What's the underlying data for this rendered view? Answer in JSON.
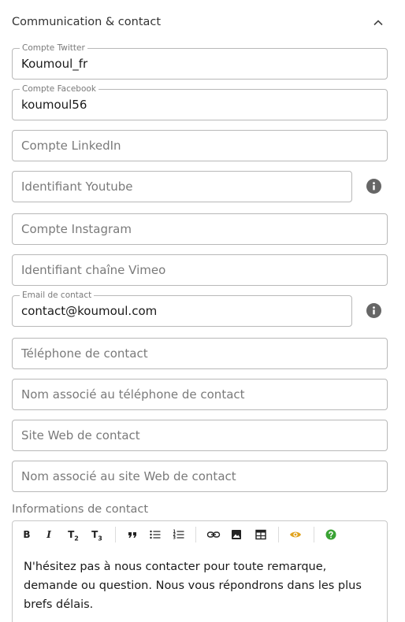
{
  "section": {
    "title": "Communication & contact"
  },
  "fields": [
    {
      "key": "twitter",
      "legend": "Compte Twitter",
      "value": "Koumoul_fr"
    },
    {
      "key": "facebook",
      "legend": "Compte Facebook",
      "value": "koumoul56"
    },
    {
      "key": "linkedin",
      "placeholder": "Compte LinkedIn"
    },
    {
      "key": "youtube",
      "placeholder": "Identifiant Youtube"
    },
    {
      "key": "instagram",
      "placeholder": "Compte Instagram"
    },
    {
      "key": "vimeo",
      "placeholder": "Identifiant chaîne Vimeo"
    },
    {
      "key": "email",
      "legend": "Email de contact",
      "value": "contact@koumoul.com"
    },
    {
      "key": "phone",
      "placeholder": "Téléphone de contact"
    },
    {
      "key": "phone_name",
      "placeholder": "Nom associé au téléphone de contact"
    },
    {
      "key": "website",
      "placeholder": "Site Web de contact"
    },
    {
      "key": "website_name",
      "placeholder": "Nom associé au site Web de contact"
    }
  ],
  "editor": {
    "label": "Informations de contact",
    "toolbar": {
      "bold": "B",
      "italic": "I",
      "title2": "T",
      "title2_sub": "2",
      "title3": "T",
      "title3_sub": "3"
    },
    "content": "N'hésitez pas à nous contacter pour toute remarque, demande ou question. Nous vous répondrons dans les plus brefs délais."
  },
  "colors": {
    "preview_icon": "#e0a21b",
    "help_icon": "#3aa334",
    "info_icon": "#666666",
    "border": "#b8b8b8"
  },
  "icons": {
    "collapse": "chevron-up-icon",
    "info": "info-icon",
    "quote": "quote-icon",
    "bullet_list": "bullet-list-icon",
    "numbered_list": "numbered-list-icon",
    "link": "link-icon",
    "image": "image-icon",
    "table": "table-icon",
    "preview": "eye-icon",
    "help": "help-icon"
  }
}
